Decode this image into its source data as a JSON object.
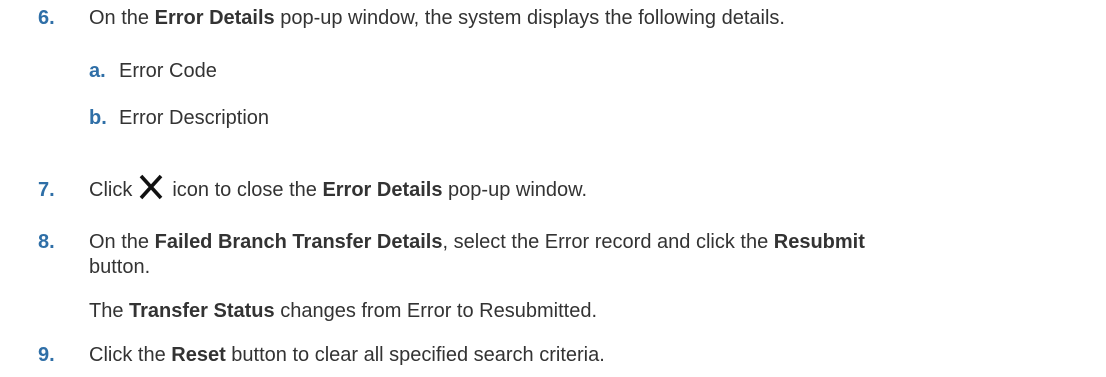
{
  "steps": [
    {
      "number": "6.",
      "pre": "On the ",
      "bold1": "Error Details",
      "post": " pop-up window, the system displays the following details.",
      "subitems": [
        {
          "letter": "a.",
          "text": "Error Code"
        },
        {
          "letter": "b.",
          "text": "Error Description"
        }
      ]
    },
    {
      "number": "7.",
      "pre": "Click",
      "icon": "close-icon",
      "mid": "icon to close the ",
      "bold1": "Error Details",
      "post": " pop-up window."
    },
    {
      "number": "8.",
      "pre": "On the ",
      "bold1": "Failed Branch Transfer Details",
      "mid": ", select the Error record and click the ",
      "bold2": "Resubmit",
      "line2": "button.",
      "note_pre": "The ",
      "note_bold": "Transfer Status",
      "note_post": " changes from Error to Resubmitted."
    },
    {
      "number": "9.",
      "pre": "Click the ",
      "bold1": "Reset",
      "post": " button to clear all specified search criteria."
    }
  ]
}
